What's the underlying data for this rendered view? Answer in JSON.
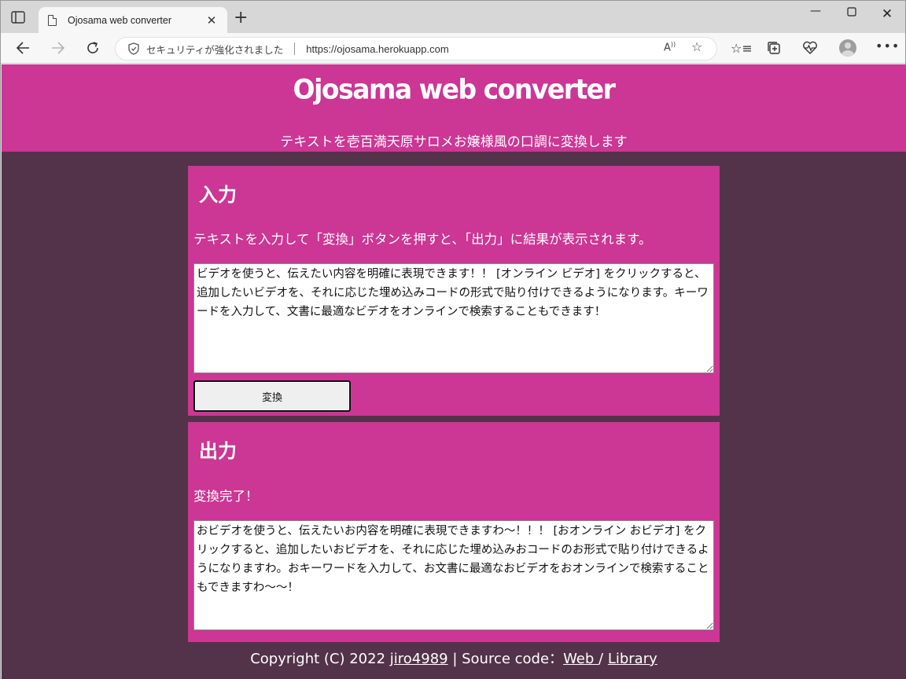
{
  "browser": {
    "tab_title": "Ojosama web converter",
    "security_text": "セキュリティが強化されました",
    "url": "https://ojosama.herokuapp.com"
  },
  "header": {
    "title": "Ojosama web converter",
    "subtitle": "テキストを壱百満天原サロメお嬢様風の口調に変換します"
  },
  "input_section": {
    "heading": "入力",
    "description": "テキストを入力して「変換」ボタンを押すと、「出力」に結果が表示されます。",
    "text": "ビデオを使うと、伝えたい内容を明確に表現できます！！ [オンライン ビデオ] をクリックすると、追加したいビデオを、それに応じた埋め込みコードの形式で貼り付けできるようになります。キーワードを入力して、文書に最適なビデオをオンラインで検索することもできます！",
    "button_label": "変換"
  },
  "output_section": {
    "heading": "出力",
    "status": "変換完了！",
    "text": "おビデオを使うと、伝えたいお内容を明確に表現できますわ～！！！ [おオンライン おビデオ] をクリックすると、追加したいおビデオを、それに応じた埋め込みおコードのお形式で貼り付けできるようになりますわ。おキーワードを入力して、お文書に最適なおビデオをおオンラインで検索することもできますわ～～！"
  },
  "footer": {
    "prefix": "Copyright (C) 2022 ",
    "author_link": "jiro4989",
    "middle": " | Source code：",
    "web_link": "Web ",
    "slash": "/ ",
    "library_link": "Library"
  },
  "colors": {
    "accent": "#cc3694",
    "background": "#533349"
  }
}
